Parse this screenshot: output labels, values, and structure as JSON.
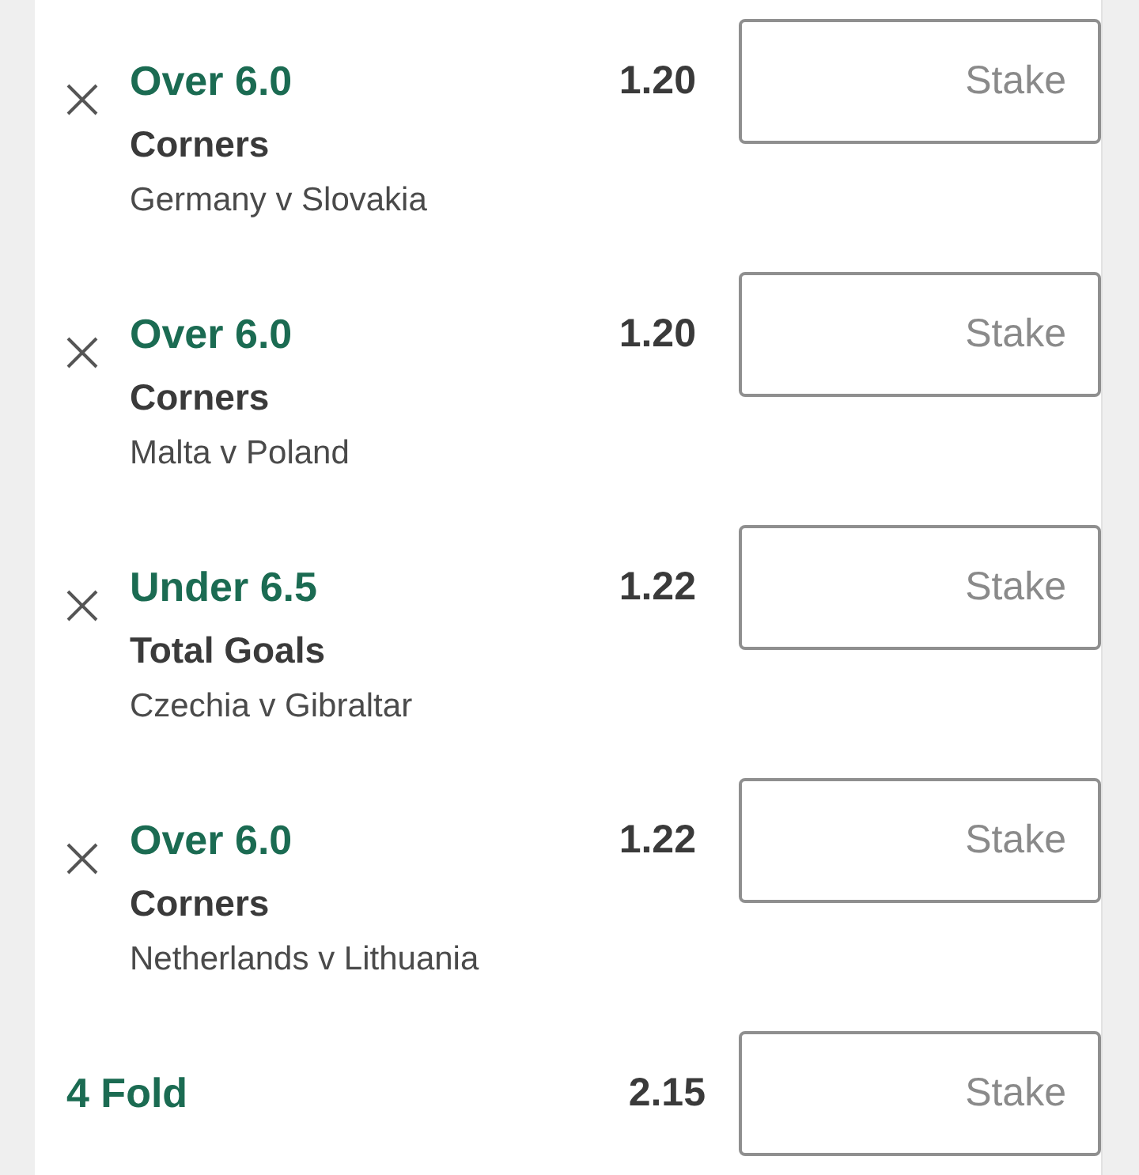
{
  "selections": [
    {
      "selection": "Over 6.0",
      "market": "Corners",
      "event": "Germany v Slovakia",
      "odds": "1.20",
      "stake_placeholder": "Stake"
    },
    {
      "selection": "Over 6.0",
      "market": "Corners",
      "event": "Malta v Poland",
      "odds": "1.20",
      "stake_placeholder": "Stake"
    },
    {
      "selection": "Under 6.5",
      "market": "Total Goals",
      "event": "Czechia v Gibraltar",
      "odds": "1.22",
      "stake_placeholder": "Stake"
    },
    {
      "selection": "Over 6.0",
      "market": "Corners",
      "event": "Netherlands v Lithuania",
      "odds": "1.22",
      "stake_placeholder": "Stake"
    }
  ],
  "multiple": {
    "label": "4 Fold",
    "odds": "2.15",
    "stake_placeholder": "Stake"
  }
}
